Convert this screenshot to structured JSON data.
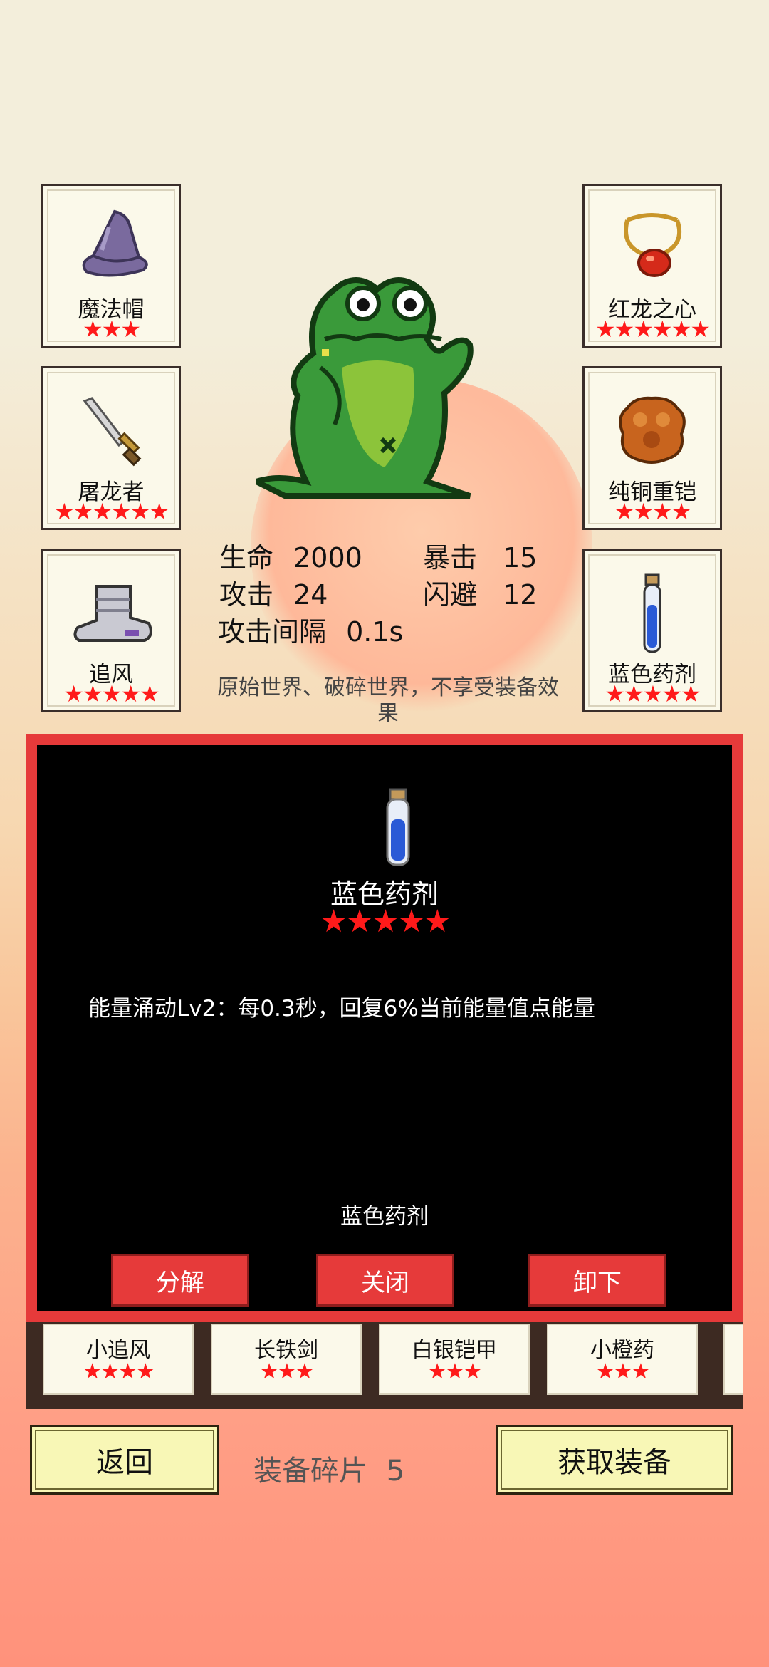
{
  "equipment": {
    "left": [
      {
        "name": "魔法帽",
        "stars": "★★★",
        "icon": "wizard-hat-icon"
      },
      {
        "name": "屠龙者",
        "stars": "★★★★★★",
        "icon": "dagger-icon"
      },
      {
        "name": "追风",
        "stars": "★★★★★",
        "icon": "boots-icon"
      }
    ],
    "right": [
      {
        "name": "红龙之心",
        "stars": "★★★★★★",
        "icon": "amulet-icon"
      },
      {
        "name": "纯铜重铠",
        "stars": "★★★★",
        "icon": "armor-icon"
      },
      {
        "name": "蓝色药剂",
        "stars": "★★★★★",
        "icon": "blue-potion-icon"
      }
    ]
  },
  "stats": {
    "hp_label": "生命",
    "hp_value": "2000",
    "crit_label": "暴击",
    "crit_value": "15",
    "atk_label": "攻击",
    "atk_value": "24",
    "dodge_label": "闪避",
    "dodge_value": "12",
    "interval_label": "攻击间隔",
    "interval_value": "0.1s"
  },
  "note": "原始世界、破碎世界，不享受装备效果",
  "detail": {
    "title": "蓝色药剂",
    "stars": "★★★★★",
    "description": "能量涌动Lv2：每0.3秒，回复6%当前能量值点能量",
    "name": "蓝色药剂",
    "buttons": {
      "decompose": "分解",
      "close": "关闭",
      "unequip": "卸下"
    }
  },
  "inventory": [
    {
      "name": "小追风",
      "stars": "★★★★"
    },
    {
      "name": "长铁剑",
      "stars": "★★★"
    },
    {
      "name": "白银铠甲",
      "stars": "★★★"
    },
    {
      "name": "小橙药",
      "stars": "★★★"
    }
  ],
  "footer": {
    "back": "返回",
    "shards_label": "装备碎片",
    "shards_value": "5",
    "get_equipment": "获取装备"
  },
  "colors": {
    "accent_red": "#e63a3a",
    "star_red": "#ff1a1a",
    "button_yellow": "#f8f7b6",
    "frog_green": "#3a9a3a"
  }
}
